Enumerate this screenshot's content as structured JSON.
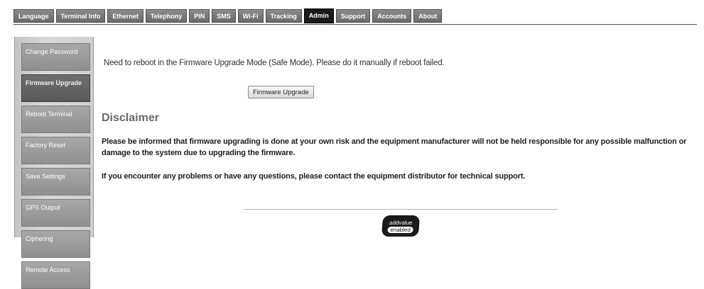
{
  "nav": {
    "tabs": [
      {
        "label": "Language"
      },
      {
        "label": "Terminal Info"
      },
      {
        "label": "Ethernet"
      },
      {
        "label": "Telephony"
      },
      {
        "label": "PIN"
      },
      {
        "label": "SMS"
      },
      {
        "label": "Wi-Fi"
      },
      {
        "label": "Tracking"
      },
      {
        "label": "Admin"
      },
      {
        "label": "Support"
      },
      {
        "label": "Accounts"
      },
      {
        "label": "About"
      }
    ],
    "active_tab": "Admin"
  },
  "sidebar": {
    "items": [
      {
        "label": "Change Password"
      },
      {
        "label": "Firmware Upgrade"
      },
      {
        "label": "Reboot Terminal"
      },
      {
        "label": "Factory Reset"
      },
      {
        "label": "Save Settings"
      },
      {
        "label": "GPS Output"
      },
      {
        "label": "Ciphering"
      },
      {
        "label": "Remote Access"
      }
    ],
    "active_item": "Firmware Upgrade"
  },
  "main": {
    "notice": "Need to reboot in the Firmware Upgrade Mode (Safe Mode). Please do it manually if reboot failed.",
    "button_label": "Firmware Upgrade",
    "disclaimer_heading": "Disclaimer",
    "disclaimer_p1": "Please be informed that firmware upgrading is done at your own risk and the equipment manufacturer will not be held responsible for any possible malfunction or damage to the system due to upgrading the firmware.",
    "disclaimer_p2": "If you encounter any problems or have any questions, please contact the equipment distributor for technical support."
  },
  "footer": {
    "logo_top": "addvalue",
    "logo_bottom": "enabled"
  }
}
